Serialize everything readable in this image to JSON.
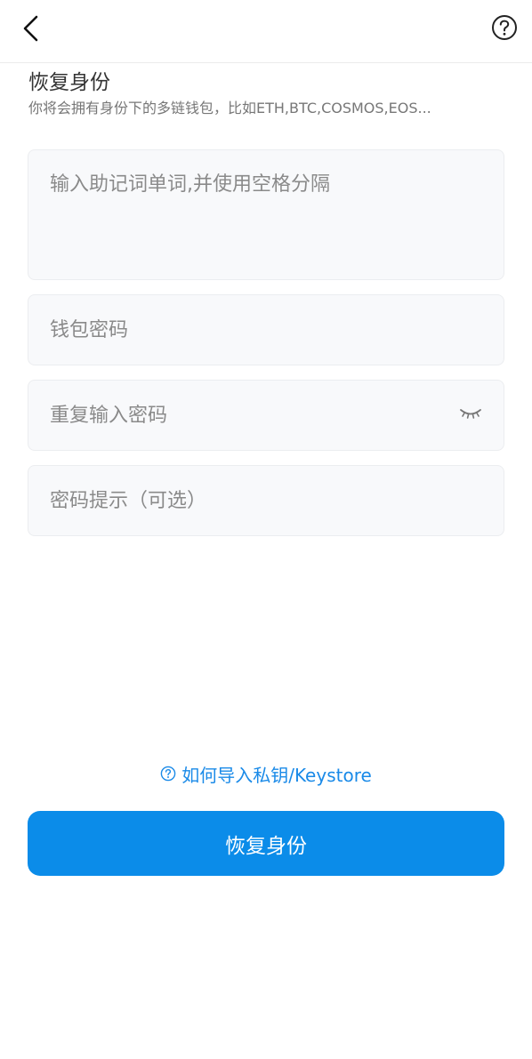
{
  "header": {
    "back_icon": "chevron-left-icon",
    "help_icon": "question-circle-icon"
  },
  "intro": {
    "title": "恢复身份",
    "subtitle": "你将会拥有身份下的多链钱包，比如ETH,BTC,COSMOS,EOS..."
  },
  "form": {
    "mnemonic_placeholder": "输入助记词单词,并使用空格分隔",
    "mnemonic_value": "",
    "password_placeholder": "钱包密码",
    "password_value": "",
    "repeat_password_placeholder": "重复输入密码",
    "repeat_password_value": "",
    "eye_icon": "eye-closed-icon",
    "hint_placeholder": "密码提示（可选）",
    "hint_value": ""
  },
  "import_link": {
    "icon": "question-circle-icon",
    "label": "如何导入私钥/Keystore"
  },
  "submit": {
    "label": "恢复身份"
  },
  "colors": {
    "accent": "#0b8ce9",
    "link": "#1a8ae8",
    "field_bg": "#f8f9fb",
    "field_border": "#ebedf0"
  }
}
